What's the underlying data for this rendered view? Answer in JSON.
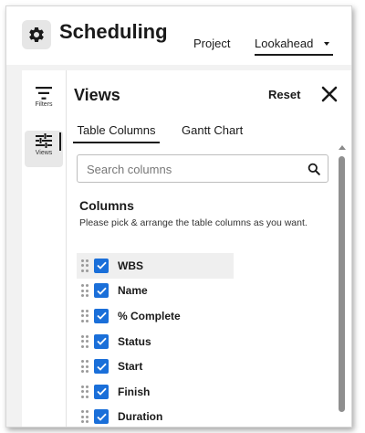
{
  "header": {
    "title": "Scheduling",
    "nav": [
      {
        "label": "Project"
      },
      {
        "label": "Lookahead"
      }
    ]
  },
  "rail": {
    "items": [
      {
        "label": "Filters",
        "icon": "filter-icon"
      },
      {
        "label": "Views",
        "icon": "sliders-icon",
        "active": true
      }
    ]
  },
  "panel": {
    "title": "Views",
    "reset_label": "Reset",
    "tabs": [
      {
        "label": "Table Columns",
        "active": true
      },
      {
        "label": "Gantt Chart",
        "active": false
      }
    ],
    "search": {
      "placeholder": "Search columns",
      "value": ""
    },
    "section_title": "Columns",
    "section_desc": "Please pick & arrange the table columns as you want.",
    "columns": [
      {
        "label": "WBS",
        "checked": true
      },
      {
        "label": "Name",
        "checked": true
      },
      {
        "label": "% Complete",
        "checked": true
      },
      {
        "label": "Status",
        "checked": true
      },
      {
        "label": "Start",
        "checked": true
      },
      {
        "label": "Finish",
        "checked": true
      },
      {
        "label": "Duration",
        "checked": true
      }
    ]
  },
  "colors": {
    "accent": "#1a6fd9",
    "text": "#1a1a1a",
    "background": "#f2f2f2"
  }
}
